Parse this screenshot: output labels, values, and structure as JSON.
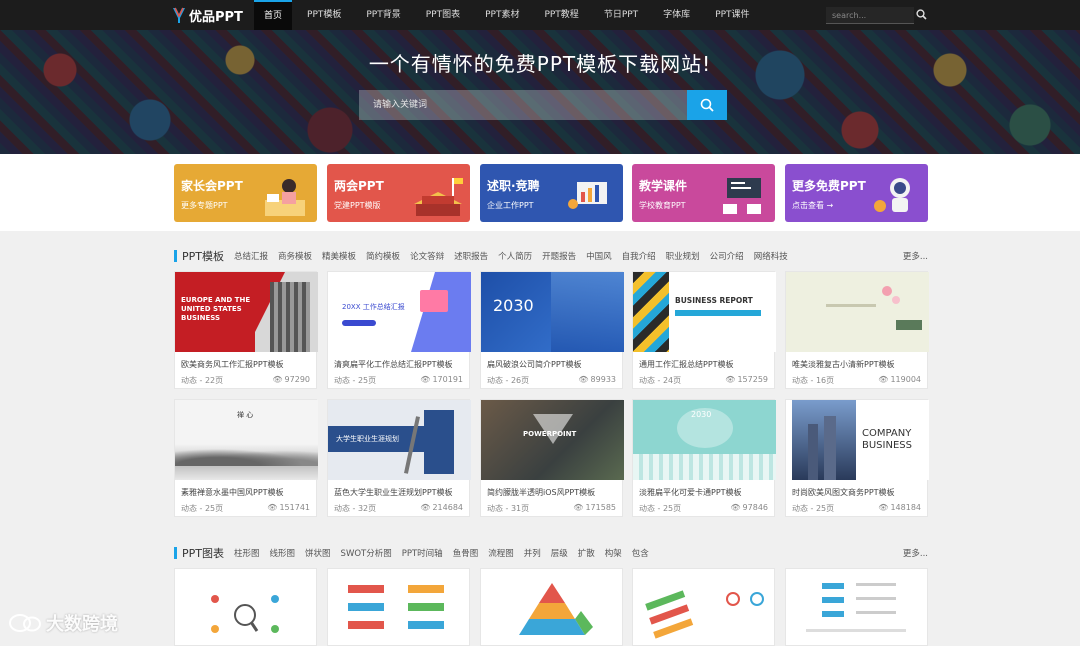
{
  "nav": {
    "logo_text": "优品PPT",
    "links": [
      "首页",
      "PPT模板",
      "PPT背景",
      "PPT图表",
      "PPT素材",
      "PPT教程",
      "节日PPT",
      "字体库",
      "PPT课件"
    ],
    "search_placeholder": "search..."
  },
  "hero": {
    "title": "一个有情怀的免费PPT模板下载网站!",
    "search_placeholder": "请输入关键词"
  },
  "banners": [
    {
      "title": "家长会PPT",
      "sub": "更多专题PPT",
      "color": "#e6a935"
    },
    {
      "title": "两会PPT",
      "sub": "党建PPT模版",
      "color": "#e2564b"
    },
    {
      "title": "述职·竞聘",
      "sub": "企业工作PPT",
      "color": "#2f56b0"
    },
    {
      "title": "教学课件",
      "sub": "学校教育PPT",
      "color": "#c9499c"
    },
    {
      "title": "更多免费PPT",
      "sub": "点击查看 →",
      "color": "#8a4fcf"
    }
  ],
  "templates_section": {
    "title": "PPT模板",
    "tags": [
      "总结汇报",
      "商务模板",
      "精美模板",
      "简约模板",
      "论文答辩",
      "述职报告",
      "个人简历",
      "开题报告",
      "中国风",
      "自我介绍",
      "职业规划",
      "公司介绍",
      "网络科技"
    ],
    "more": "更多..."
  },
  "cards": [
    {
      "title": "欧美商务风工作汇报PPT模板",
      "meta": "动态 - 22页",
      "views": "97290",
      "thumb_text": "EUROPE AND THE UNITED STATES BUSINESS"
    },
    {
      "title": "清爽扁平化工作总结汇报PPT模板",
      "meta": "动态 - 25页",
      "views": "170191",
      "thumb_text": "20XX 工作总结汇报"
    },
    {
      "title": "扁风破浪公司简介PPT模板",
      "meta": "动态 - 26页",
      "views": "89933",
      "thumb_text": "2030"
    },
    {
      "title": "通用工作汇报总结PPT模板",
      "meta": "动态 - 24页",
      "views": "157259",
      "thumb_text": "BUSINESS REPORT"
    },
    {
      "title": "唯美淡雅复古小清新PPT模板",
      "meta": "动态 - 16页",
      "views": "119004",
      "thumb_text": ""
    },
    {
      "title": "素雅禅意水墨中国风PPT模板",
      "meta": "动态 - 25页",
      "views": "151741",
      "thumb_text": "禅 心"
    },
    {
      "title": "蓝色大学生职业生涯规划PPT模板",
      "meta": "动态 - 32页",
      "views": "214684",
      "thumb_text": "大学生职业生涯规划"
    },
    {
      "title": "简约朦胧半透明iOS风PPT模板",
      "meta": "动态 - 31页",
      "views": "171585",
      "thumb_text": "POWERPOINT"
    },
    {
      "title": "淡雅扁平化可爱卡通PPT模板",
      "meta": "动态 - 25页",
      "views": "97846",
      "thumb_text": "2030"
    },
    {
      "title": "时尚欧美风图文商务PPT模板",
      "meta": "动态 - 25页",
      "views": "148184",
      "thumb_text": "COMPANY BUSINESS"
    }
  ],
  "charts_section": {
    "title": "PPT图表",
    "tags": [
      "柱形图",
      "线形图",
      "饼状图",
      "SWOT分析图",
      "PPT时间轴",
      "鱼骨图",
      "流程图",
      "并列",
      "层级",
      "扩散",
      "构架",
      "包含"
    ],
    "more": "更多..."
  },
  "watermark": "大数跨境"
}
